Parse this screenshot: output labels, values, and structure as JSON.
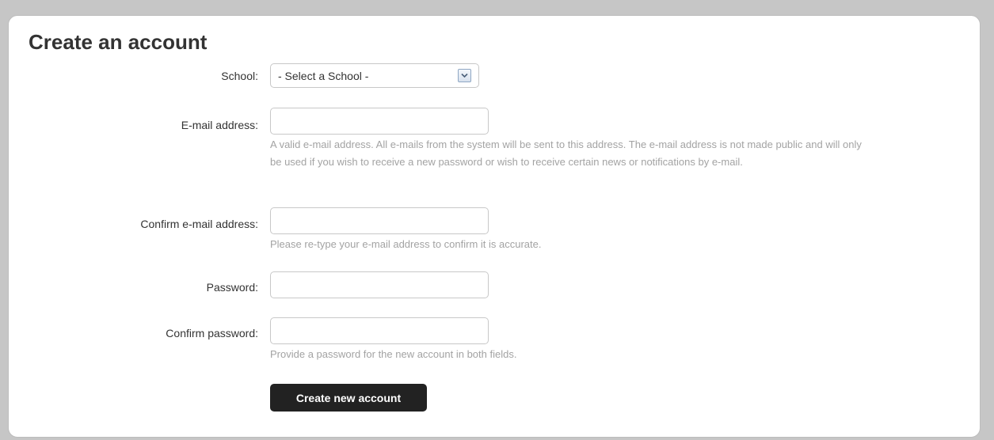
{
  "page": {
    "title": "Create an account"
  },
  "form": {
    "school": {
      "label": "School:",
      "selected": "- Select a School -",
      "icon": "chevron-down-icon"
    },
    "email": {
      "label": "E-mail address:",
      "value": "",
      "help": "A valid e-mail address. All e-mails from the system will be sent to this address. The e-mail address is not made public and will only be used if you wish to receive a new password or wish to receive certain news or notifications by e-mail."
    },
    "confirm_email": {
      "label": "Confirm e-mail address:",
      "value": "",
      "help": "Please re-type your e-mail address to confirm it is accurate."
    },
    "password": {
      "label": "Password:",
      "value": ""
    },
    "confirm_password": {
      "label": "Confirm password:",
      "value": "",
      "help": "Provide a password for the new account in both fields."
    },
    "submit_label": "Create new account"
  },
  "colors": {
    "background": "#c6c6c6",
    "panel": "#ffffff",
    "text": "#333333",
    "help_text": "#a3a3a3",
    "button": "#222222",
    "button_text": "#ffffff"
  }
}
